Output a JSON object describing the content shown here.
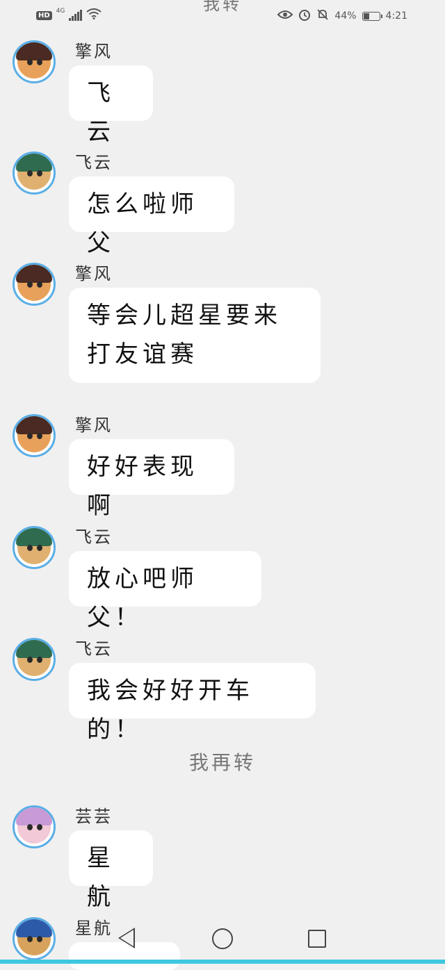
{
  "status_bar": {
    "top_cut_text": "我转",
    "hd": "HD",
    "network": "4G",
    "battery_percent": "44%",
    "time": "4:21",
    "battery_level": 0.44
  },
  "messages": [
    {
      "sender": "擎风",
      "text": "飞云",
      "avatar": "qingfeng"
    },
    {
      "sender": "飞云",
      "text": "怎么啦师父",
      "avatar": "feiyun"
    },
    {
      "sender": "擎风",
      "text": "等会儿超星要来打友谊赛",
      "avatar": "qingfeng"
    },
    {
      "sender": "擎风",
      "text": "好好表现啊",
      "avatar": "qingfeng"
    },
    {
      "sender": "飞云",
      "text": "放心吧师父！",
      "avatar": "feiyun"
    },
    {
      "sender": "飞云",
      "text": "我会好好开车的！",
      "avatar": "feiyun"
    },
    {
      "sender": "芸芸",
      "text": "星航",
      "avatar": "yunyun"
    },
    {
      "sender": "星航",
      "text": "",
      "avatar": "xinghang"
    }
  ],
  "system_message": "我再转",
  "navigation": [
    "back",
    "home",
    "recents"
  ]
}
